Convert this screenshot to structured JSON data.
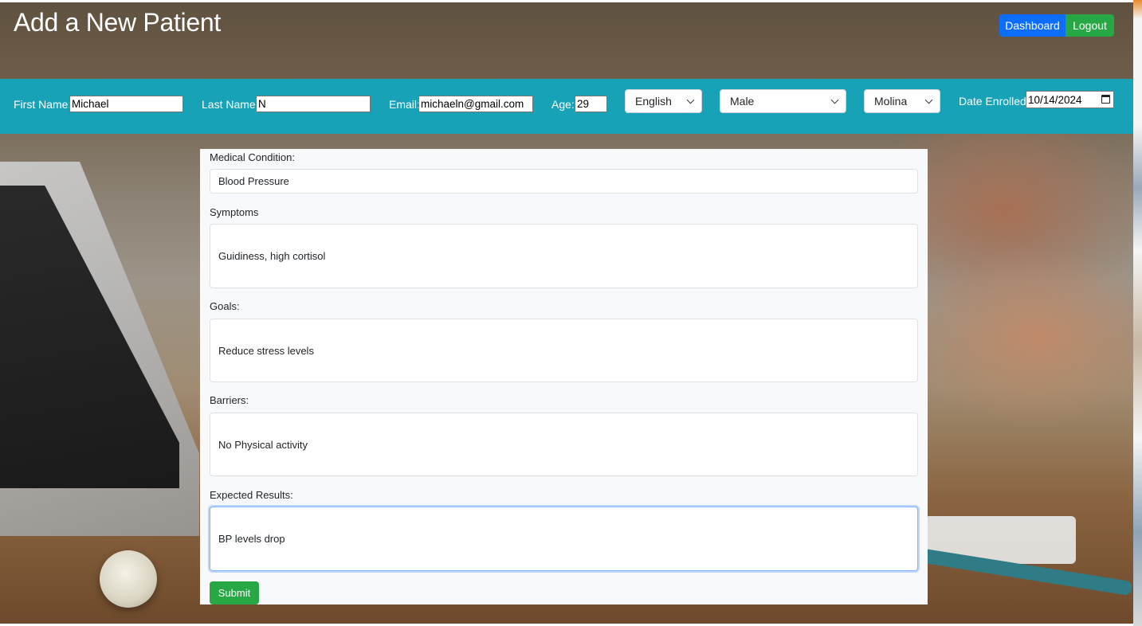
{
  "header": {
    "title": "Add a New Patient",
    "dashboard_label": "Dashboard",
    "logout_label": "Logout"
  },
  "patient_bar": {
    "first_name_label": "First Name:",
    "first_name_value": "Michael",
    "last_name_label": "Last Name:",
    "last_name_value": "N",
    "email_label": "Email:",
    "email_value": "michaeln@gmail.com",
    "age_label": "Age:",
    "age_value": "29",
    "language_selected": "English",
    "gender_selected": "Male",
    "provider_selected": "Molina",
    "date_enrolled_label": "Date Enrolled:",
    "date_enrolled_value": "10/14/2024"
  },
  "form": {
    "medical_condition_label": "Medical Condition:",
    "medical_condition_value": "Blood Pressure",
    "symptoms_label": "Symptoms",
    "symptoms_value": "Guidiness, high cortisol",
    "goals_label": "Goals:",
    "goals_value": "Reduce stress levels",
    "barriers_label": "Barriers:",
    "barriers_value": "No Physical activity",
    "expected_results_label": "Expected Results:",
    "expected_results_value": "BP levels drop",
    "submit_label": "Submit"
  },
  "colors": {
    "info_bar": "#17a2b8",
    "dashboard_button": "#0d6efd",
    "logout_button": "#28a745",
    "submit_button": "#28a745"
  }
}
